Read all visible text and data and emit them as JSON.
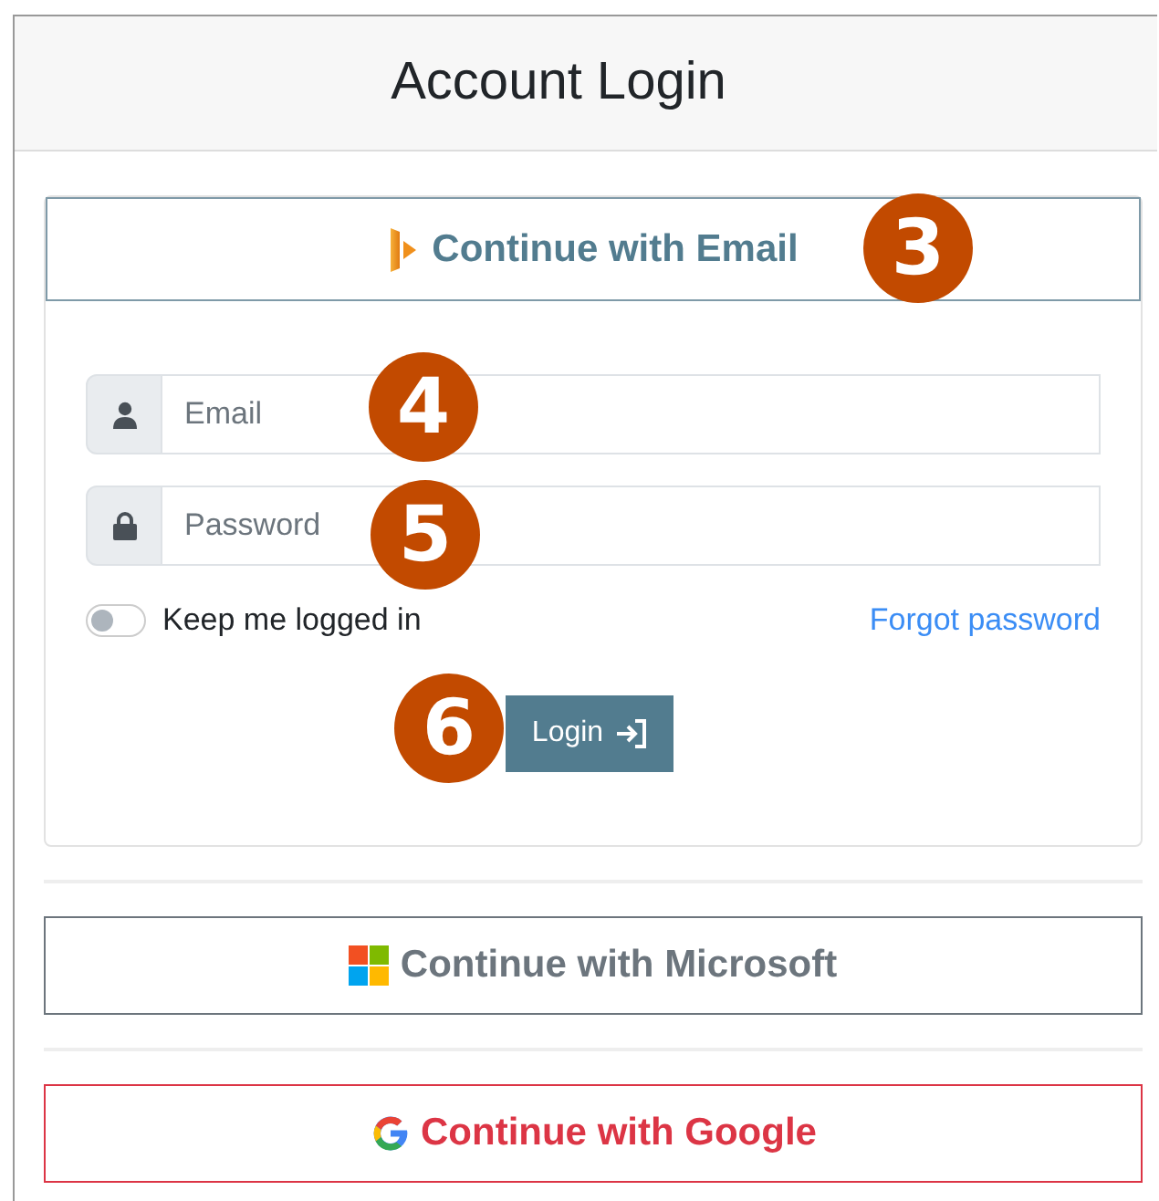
{
  "title": "Account Login",
  "email_section": {
    "button": "Continue with Email",
    "callout": "3",
    "fields": [
      {
        "kind": "email",
        "placeholder": "Email",
        "callout": "4"
      },
      {
        "kind": "password",
        "placeholder": "Password",
        "callout": "5"
      }
    ],
    "keep_logged_in": {
      "label": "Keep me logged in",
      "on": false
    },
    "forgot_link": "Forgot password",
    "login_button": {
      "label": "Login",
      "callout": "6"
    }
  },
  "providers": [
    {
      "kind": "microsoft",
      "label": "Continue with Microsoft"
    },
    {
      "kind": "google",
      "label": "Continue with Google"
    }
  ]
}
